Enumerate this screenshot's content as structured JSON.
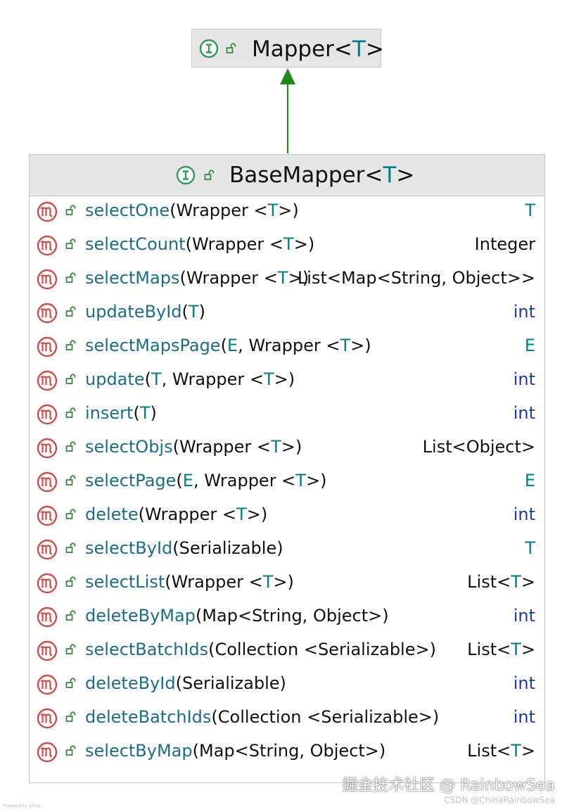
{
  "parent": {
    "name": "Mapper",
    "type_param": "T"
  },
  "interface": {
    "name": "BaseMapper",
    "type_param": "T"
  },
  "methods": [
    {
      "name": "selectOne",
      "params": "(Wrapper <T>)",
      "returns": "T",
      "ret_kind": "tvar"
    },
    {
      "name": "selectCount",
      "params": "(Wrapper <T>)",
      "returns": "Integer",
      "ret_kind": "class"
    },
    {
      "name": "selectMaps",
      "params": "(Wrapper <T>)",
      "returns": "List<Map<String, Object>>",
      "ret_kind": "class"
    },
    {
      "name": "updateById",
      "params": "(T)",
      "returns": "int",
      "ret_kind": "prim"
    },
    {
      "name": "selectMapsPage",
      "params": "(E, Wrapper <T>)",
      "returns": "E",
      "ret_kind": "tvar"
    },
    {
      "name": "update",
      "params": "(T, Wrapper <T>)",
      "returns": "int",
      "ret_kind": "prim"
    },
    {
      "name": "insert",
      "params": "(T)",
      "returns": "int",
      "ret_kind": "prim"
    },
    {
      "name": "selectObjs",
      "params": "(Wrapper <T>)",
      "returns": "List<Object>",
      "ret_kind": "class"
    },
    {
      "name": "selectPage",
      "params": "(E, Wrapper <T>)",
      "returns": "E",
      "ret_kind": "tvar"
    },
    {
      "name": "delete",
      "params": "(Wrapper <T>)",
      "returns": "int",
      "ret_kind": "prim"
    },
    {
      "name": "selectById",
      "params": "(Serializable)",
      "returns": "T",
      "ret_kind": "tvar"
    },
    {
      "name": "selectList",
      "params": "(Wrapper <T>)",
      "returns": "List<T>",
      "ret_kind": "class"
    },
    {
      "name": "deleteByMap",
      "params": "(Map<String, Object>)",
      "returns": "int",
      "ret_kind": "prim"
    },
    {
      "name": "selectBatchIds",
      "params": "(Collection <Serializable>)",
      "returns": "List<T>",
      "ret_kind": "class"
    },
    {
      "name": "deleteById",
      "params": "(Serializable)",
      "returns": "int",
      "ret_kind": "prim"
    },
    {
      "name": "deleteBatchIds",
      "params": "(Collection <Serializable>)",
      "returns": "int",
      "ret_kind": "prim"
    },
    {
      "name": "selectByMap",
      "params": "(Map<String, Object>)",
      "returns": "List<T>",
      "ret_kind": "class"
    }
  ],
  "colors": {
    "interface_icon": "#2e9a5c",
    "method_icon": "#d24a4a",
    "lock_icon": "#3b8a3b",
    "arrow": "#1b8a1b",
    "type_var": "#00808c",
    "primitive": "#1c3aa8",
    "method_name": "#1a6e88"
  },
  "watermark": {
    "main": "掘金技术社区 @ RainbowSea",
    "sub": "CSDN @ChinaRainbowSea",
    "tool": "Powered by yFiles"
  }
}
